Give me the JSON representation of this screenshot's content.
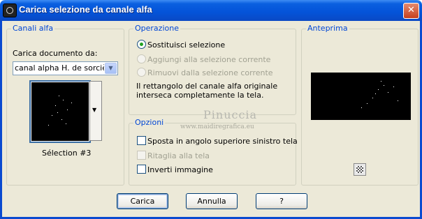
{
  "window": {
    "title": "Carica selezione da canale alfa",
    "close_glyph": "✕",
    "icon": "app-icon"
  },
  "channels": {
    "legend": "Canali alfa",
    "load_label": "Carica documento da:",
    "select_value": "canal alpha H. de sorcières",
    "selection_name": "Sélection #3",
    "dropdown_glyph": "▼"
  },
  "operation": {
    "legend": "Operazione",
    "options": [
      {
        "label": "Sostituisci selezione",
        "selected": true,
        "enabled": true
      },
      {
        "label": "Aggiungi alla selezione corrente",
        "selected": false,
        "enabled": false
      },
      {
        "label": "Rimuovi dalla selezione corrente",
        "selected": false,
        "enabled": false
      }
    ],
    "note_line1": "Il rettangolo del canale alfa originale",
    "note_line2": "interseca completamente la tela."
  },
  "options": {
    "legend": "Opzioni",
    "items": [
      {
        "label": "Sposta in angolo superiore sinistro tela",
        "checked": false,
        "enabled": true
      },
      {
        "label": "Ritaglia alla tela",
        "checked": false,
        "enabled": false
      },
      {
        "label": "Inverti immagine",
        "checked": false,
        "enabled": true
      }
    ]
  },
  "preview": {
    "legend": "Anteprima"
  },
  "watermark": {
    "line1": "Pinuccia",
    "line2": "www.maidiregrafica.eu"
  },
  "buttons": {
    "load": "Carica",
    "cancel": "Annulla",
    "help": "?"
  }
}
